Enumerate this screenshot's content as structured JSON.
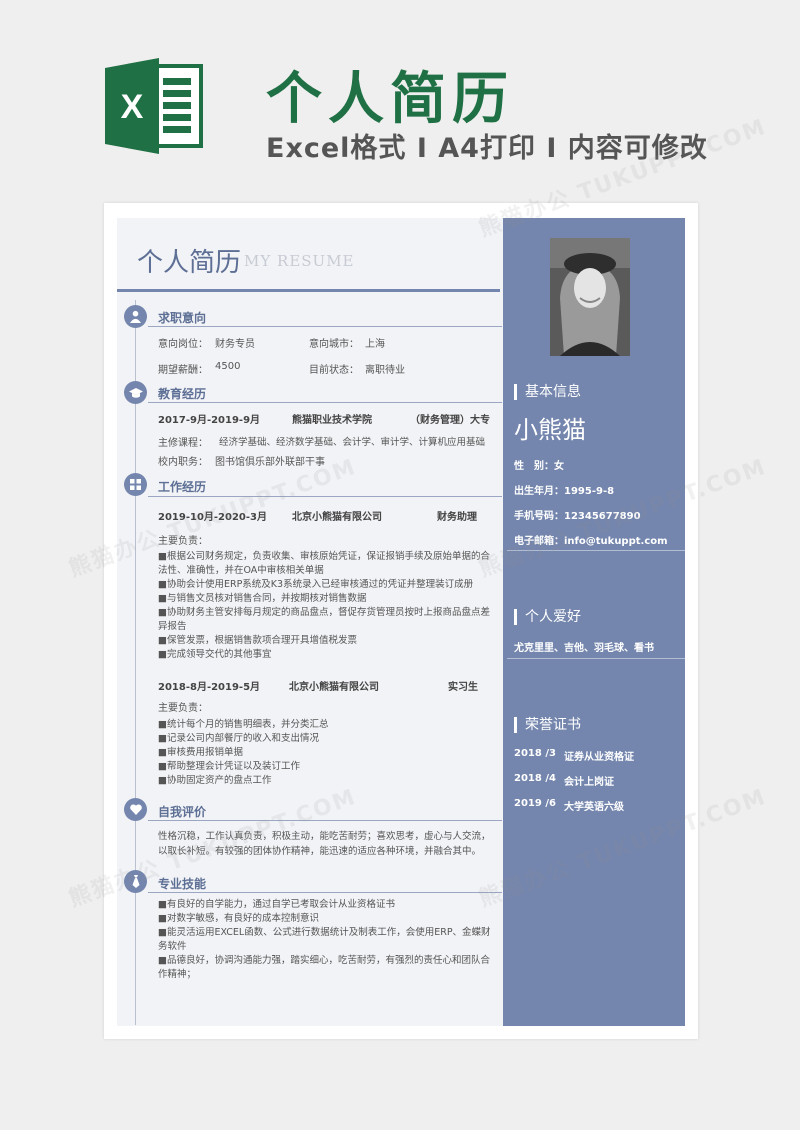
{
  "banner": {
    "title": "个人简历",
    "subtitle": "Excel格式 I A4打印 I 内容可修改",
    "logo_letter": "X"
  },
  "resume": {
    "title_cn": "个人简历",
    "title_en": "MY RESUME"
  },
  "intent": {
    "heading": "求职意向",
    "position_label": "意向岗位：",
    "position_value": "财务专员",
    "city_label": "意向城市：",
    "city_value": "上海",
    "salary_label": "期望薪酬：",
    "salary_value": "4500",
    "status_label": "目前状态：",
    "status_value": "离职待业"
  },
  "education": {
    "heading": "教育经历",
    "period": "2017-9月-2019-9月",
    "school": "熊猫职业技术学院",
    "major": "（财务管理）大专",
    "courses_label": "主修课程：",
    "courses_value": "经济学基础、经济数学基础、会计学、审计学、计算机应用基础",
    "role_label": "校内职务：",
    "role_value": "图书馆俱乐部外联部干事"
  },
  "work": {
    "heading": "工作经历",
    "jobs": [
      {
        "period": "2019-10月-2020-3月",
        "company": "北京小熊猫有限公司",
        "title": "财务助理",
        "duty_label": "主要负责：",
        "lines": [
          "■根据公司财务规定，负责收集、审核原始凭证，保证报销手续及原始单据的合",
          "法性、准确性，并在OA中审核相关单据",
          "■协助会计使用ERP系统及K3系统录入已经审核通过的凭证并整理装订成册",
          "■与销售文员核对销售合同，并按期核对销售数据",
          "■协助财务主管安排每月规定的商品盘点，督促存货管理员按时上报商品盘点差",
          "异报告",
          "■保管发票，根据销售款项合理开具增值税发票",
          "■完成领导交代的其他事宜"
        ]
      },
      {
        "period": "2018-8月-2019-5月",
        "company": "北京小熊猫有限公司",
        "title": "实习生",
        "duty_label": "主要负责：",
        "lines": [
          "■统计每个月的销售明细表，并分类汇总",
          "■记录公司内部餐厅的收入和支出情况",
          "■审核费用报销单据",
          "■帮助整理会计凭证以及装订工作",
          "■协助固定资产的盘点工作"
        ]
      }
    ]
  },
  "evaluation": {
    "heading": "自我评价",
    "lines": [
      "性格沉稳，工作认真负责，积极主动，能吃苦耐劳；喜欢思考，虚心与人交流，",
      "以取长补短。有较强的团体协作精神，能迅速的适应各种环境，并融合其中。"
    ]
  },
  "skills": {
    "heading": "专业技能",
    "lines": [
      "■有良好的自学能力，通过自学已考取会计从业资格证书",
      "■对数字敏感，有良好的成本控制意识",
      "■能灵活运用EXCEL函数、公式进行数据统计及制表工作，会使用ERP、金蝶财",
      "务软件",
      "■品德良好，协调沟通能力强，踏实细心，吃苦耐劳，有强烈的责任心和团队合",
      "作精神；"
    ]
  },
  "sidebar": {
    "basic_heading": "基本信息",
    "name": "小熊猫",
    "gender": "性　别：女",
    "birth": "出生年月：1995-9-8",
    "phone": "手机号码：12345677890",
    "email": "电子邮箱：info@tukuppt.com",
    "hobby_heading": "个人爱好",
    "hobby_value": "尤克里里、吉他、羽毛球、看书",
    "honor_heading": "荣誉证书",
    "honors": [
      {
        "date": "2018 /3",
        "name": "证券从业资格证"
      },
      {
        "date": "2018 /4",
        "name": "会计上岗证"
      },
      {
        "date": "2019 /6",
        "name": "大学英语六级"
      }
    ]
  },
  "watermark": "熊猫办公 TUKUPPT.COM",
  "colors": {
    "accent": "#7486ad",
    "brand_green": "#1f7044",
    "main_bg": "#f2f3f6"
  }
}
